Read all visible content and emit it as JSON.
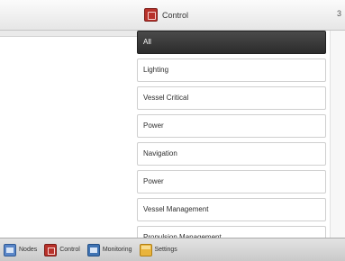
{
  "window": {
    "title": "Control",
    "corner_glyph": "3",
    "title_icon": "control-icon"
  },
  "list": {
    "items": [
      {
        "label": "All",
        "selected": true
      },
      {
        "label": "Lighting",
        "selected": false
      },
      {
        "label": "Vessel Critical",
        "selected": false
      },
      {
        "label": "Power",
        "selected": false
      },
      {
        "label": "Navigation",
        "selected": false
      },
      {
        "label": "Power",
        "selected": false
      },
      {
        "label": "Vessel Management",
        "selected": false
      },
      {
        "label": "Propulsion Management",
        "selected": false
      }
    ]
  },
  "tabbar": {
    "tabs": [
      {
        "label": "Nodes",
        "icon": "nodes-icon"
      },
      {
        "label": "Control",
        "icon": "control-icon"
      },
      {
        "label": "Monitoring",
        "icon": "monitoring-icon"
      },
      {
        "label": "Settings",
        "icon": "settings-icon"
      }
    ]
  },
  "colors": {
    "selected_bg": "#2c2c2c",
    "control_red": "#b8312a",
    "monitoring_blue": "#3f73b3",
    "settings_yellow": "#e9b43c"
  }
}
